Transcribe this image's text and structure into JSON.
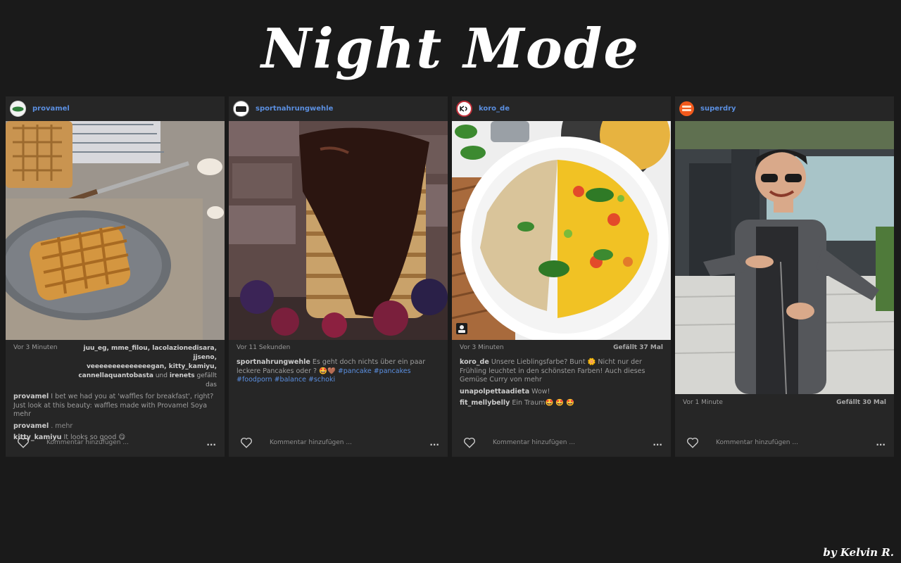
{
  "header": {
    "title": "Night Mode"
  },
  "signature": "by Kelvin R.",
  "posts": [
    {
      "username": "provamel",
      "timestamp": "Vor 3 Minuten",
      "likers_line1": "juu_eg, mme_filou, lacolazionedisara, jjseno,",
      "likers_line2": "veeeeeeeeeeeeeegan, kitty_kamiyu,",
      "likers_line3_names": "cannellaquantobasta",
      "likers_and": "und",
      "likers_last": "irenets",
      "likers_suffix": "gefällt das",
      "caption_user": "provamel",
      "caption": "I bet we had you at 'waffles for breakfast', right? Just look at this beauty: waffles made with Provamel Soya mehr",
      "comment2_user": "provamel",
      "comment2_text": ". mehr",
      "comment3_user": "kitty_kamiyu",
      "comment3_text": "It looks so good 😋",
      "comment_placeholder": "Kommentar hinzufügen ...",
      "more_dots": "..."
    },
    {
      "username": "sportnahrungwehle",
      "timestamp": "Vor 11 Sekunden",
      "caption_user": "sportnahrungwehle",
      "caption_text": "Es geht doch nichts über ein paar leckere Pancakes oder ? 🤩🤎",
      "hashtags1": "#pancake #pancakes #foodporn",
      "hashtags2": "#balance #schoki",
      "comment_placeholder": "Kommentar hinzufügen ...",
      "more_dots": "..."
    },
    {
      "username": "koro_de",
      "timestamp": "Vor 3 Minuten",
      "likes": "Gefällt 37 Mal",
      "caption_user": "koro_de",
      "caption_text": "Unsere Lieblingsfarbe? Bunt 🌼 Nicht nur der Frühling leuchtet in den schönsten Farben! Auch dieses Gemüse Curry von mehr",
      "comment2_user": "unapolpettaadieta",
      "comment2_text": "Wow!",
      "comment3_user": "fit_mellybelly",
      "comment3_text": "Ein Traum🤩 🤩 🤩",
      "comment_placeholder": "Kommentar hinzufügen ...",
      "more_dots": "..."
    },
    {
      "username": "superdry",
      "timestamp": "Vor 1 Minute",
      "likes": "Gefällt 30 Mal",
      "comment_placeholder": "Kommentar hinzufügen ...",
      "more_dots": "..."
    }
  ],
  "colors": {
    "background": "#1a1a1a",
    "card": "#262626",
    "link": "#5b8fe0"
  }
}
